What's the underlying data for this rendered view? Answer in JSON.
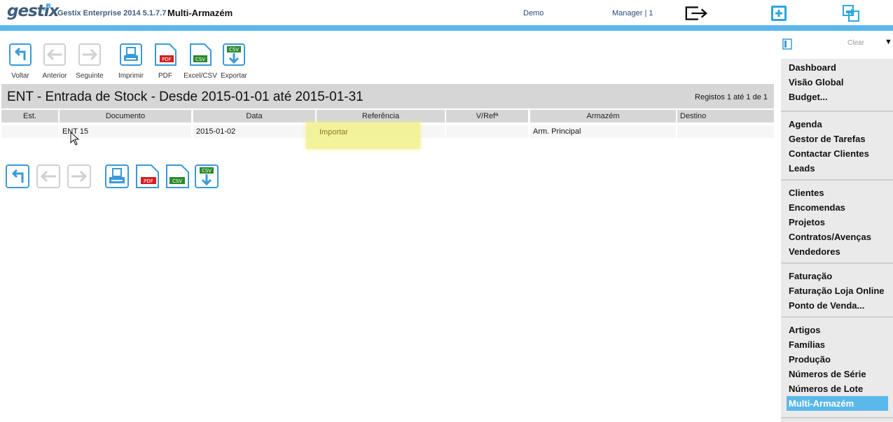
{
  "header": {
    "logo": "gestix",
    "app_name": "Gestix Enterprise 2014 5.1.7.7",
    "module": "Multi-Armazém",
    "company": "Demo",
    "user": "Manager | 1",
    "icons": [
      "logout-icon",
      "new-window-icon",
      "refresh-window-icon"
    ]
  },
  "toolbar": {
    "back": "Voltar",
    "previous": "Anterior",
    "next": "Seguinte",
    "print": "Imprimir",
    "pdf": "PDF",
    "excel": "Excel/CSV",
    "export": "Exportar",
    "pdf_tag": "PDF",
    "csv_tag": "CSV"
  },
  "report": {
    "title": "ENT - Entrada de Stock - Desde 2015-01-01 até 2015-01-31",
    "records": "Registos 1 até 1 de 1"
  },
  "table": {
    "columns": [
      "Est.",
      "Documento",
      "Data",
      "Referência",
      "V/Refª",
      "Armazém",
      "Destino"
    ],
    "rows": [
      {
        "est": "",
        "documento": "ENT 15",
        "data": "2015-01-02",
        "referencia": "Importar",
        "vref": "",
        "armazem": "Arm. Principal",
        "destino": ""
      }
    ]
  },
  "sidebar": {
    "clear": "Clear",
    "caret": "▼",
    "groups": [
      [
        "Dashboard",
        "Visão Global",
        "Budget..."
      ],
      [
        "Agenda",
        "Gestor de Tarefas",
        "Contactar Clientes",
        "Leads"
      ],
      [
        "Clientes",
        "Encomendas",
        "Projetos",
        "Contratos/Avenças",
        "Vendedores"
      ],
      [
        "Faturação",
        "Faturação Loja Online",
        "Ponto de Venda..."
      ],
      [
        "Artigos",
        "Famílias",
        "Produção",
        "Números de Série",
        "Números de Lote",
        "Multi-Armazém"
      ]
    ],
    "active": "Multi-Armazém"
  },
  "colors": {
    "accent": "#5bb8ea",
    "header_gray": "#d6d6d6",
    "highlight": "#f1f28a",
    "logo": "#3f5d7e"
  }
}
